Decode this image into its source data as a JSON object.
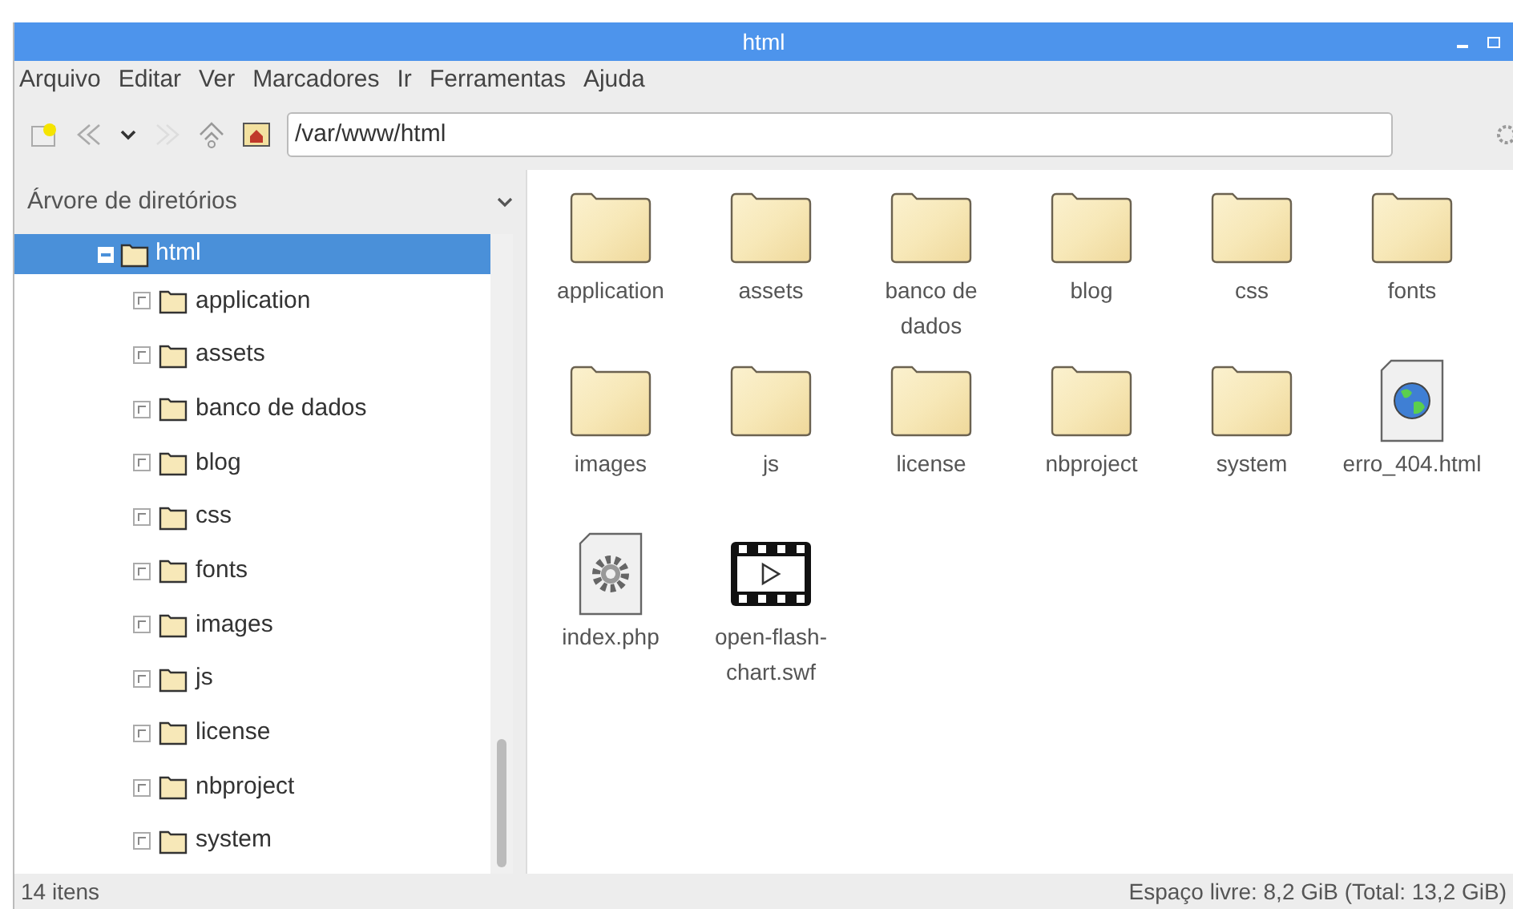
{
  "window": {
    "title": "html"
  },
  "menu": [
    "Arquivo",
    "Editar",
    "Ver",
    "Marcadores",
    "Ir",
    "Ferramentas",
    "Ajuda"
  ],
  "address": {
    "value": "/var/www/html"
  },
  "sidebar": {
    "title": "Árvore de diretórios",
    "tree": [
      {
        "label": "html",
        "selected": true,
        "expanded": true,
        "children": [
          {
            "label": "application",
            "selected": false,
            "expanded": false
          },
          {
            "label": "assets",
            "selected": false,
            "expanded": false
          },
          {
            "label": "banco de dados",
            "selected": false,
            "expanded": false
          },
          {
            "label": "blog",
            "selected": false,
            "expanded": false
          },
          {
            "label": "css",
            "selected": false,
            "expanded": false
          },
          {
            "label": "fonts",
            "selected": false,
            "expanded": false
          },
          {
            "label": "images",
            "selected": false,
            "expanded": false
          },
          {
            "label": "js",
            "selected": false,
            "expanded": false
          },
          {
            "label": "license",
            "selected": false,
            "expanded": false
          },
          {
            "label": "nbproject",
            "selected": false,
            "expanded": false
          },
          {
            "label": "system",
            "selected": false,
            "expanded": false
          }
        ]
      }
    ]
  },
  "files": [
    {
      "name": "application",
      "kind": "folder"
    },
    {
      "name": "assets",
      "kind": "folder"
    },
    {
      "name": "banco de dados",
      "kind": "folder"
    },
    {
      "name": "blog",
      "kind": "folder"
    },
    {
      "name": "css",
      "kind": "folder"
    },
    {
      "name": "fonts",
      "kind": "folder"
    },
    {
      "name": "images",
      "kind": "folder"
    },
    {
      "name": "js",
      "kind": "folder"
    },
    {
      "name": "license",
      "kind": "folder"
    },
    {
      "name": "nbproject",
      "kind": "folder"
    },
    {
      "name": "system",
      "kind": "folder"
    },
    {
      "name": "erro_404.html",
      "kind": "web"
    },
    {
      "name": "index.php",
      "kind": "script"
    },
    {
      "name": "open-flash-chart.swf",
      "kind": "video"
    }
  ],
  "status_bar": {
    "count": "14 itens",
    "free_space": "Espaço livre: 8,2 GiB (Total: 13,2 GiB)"
  }
}
